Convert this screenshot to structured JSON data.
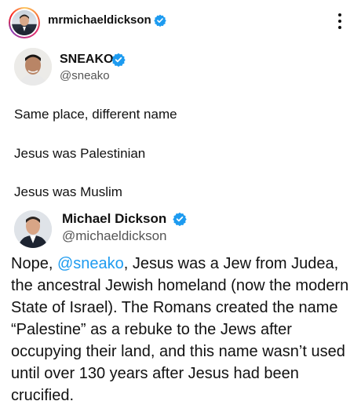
{
  "post": {
    "username": "mrmichaeldickson",
    "verified_color": "#1d9bf0"
  },
  "quoted_tweet": {
    "name": "SNEAKO",
    "handle": "@sneako",
    "lines": [
      "Same place, different name",
      "Jesus was Palestinian",
      "Jesus was Muslim"
    ]
  },
  "reply_tweet": {
    "name": "Michael Dickson",
    "handle": "@michaeldickson",
    "text_prefix": "Nope, ",
    "mention": "@sneako",
    "text_rest": ", Jesus was a Jew from Judea, the ancestral Jewish homeland (now the modern State of Israel). The Romans created the name “Palestine” as a rebuke to the Jews after occupying their land, and this name wasn’t used until over 130 years after Jesus had been crucified."
  }
}
